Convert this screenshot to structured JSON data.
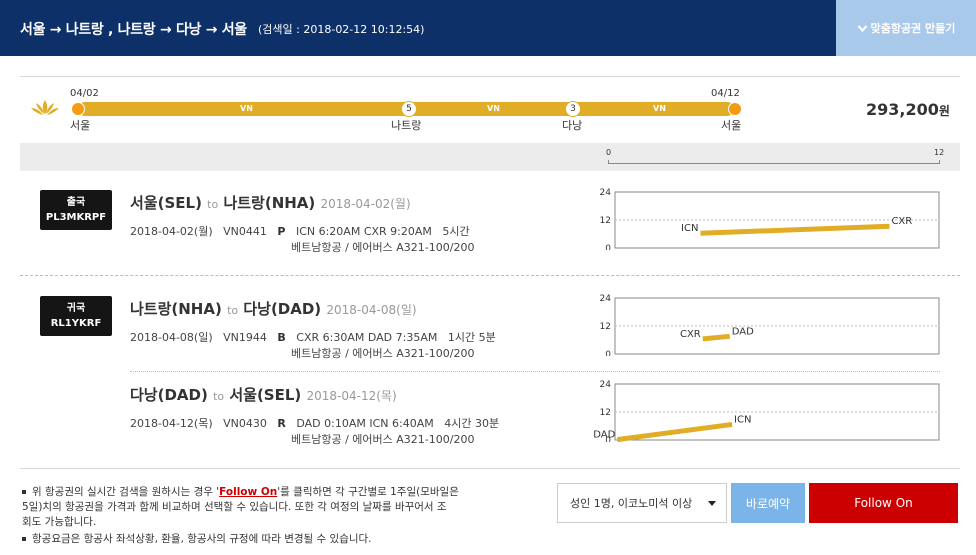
{
  "header": {
    "route": "서울 → 나트랑 , 나트랑 → 다낭 → 서울",
    "search_date": "(검색일 : 2018-02-12 10:12:54)",
    "custom_button": "맞춤항공권 만들기"
  },
  "summary": {
    "start_date": "04/02",
    "end_date": "04/12",
    "airline_code": "VN",
    "stops": [
      {
        "city": "서울"
      },
      {
        "day": "5",
        "city": "나트랑"
      },
      {
        "day": "3",
        "city": "다낭"
      },
      {
        "city": "서울"
      }
    ],
    "price": "293,200",
    "price_unit": "원",
    "scale_min": "0",
    "scale_max": "12"
  },
  "segments": [
    {
      "badge_type": "출국",
      "badge_code": "PL3MKRPF",
      "from": "서울(SEL)",
      "to_word": "to",
      "to": "나트랑(NHA)",
      "date_text": "2018-04-02(월)",
      "flights": [
        {
          "date": "2018-04-02(월)",
          "flight_no": "VN0441",
          "class": "P",
          "times": "ICN 6:20AM CXR 9:20AM",
          "duration": "5시간",
          "airline": "베트남항공 / 에어버스 A321-100/200"
        }
      ]
    },
    {
      "badge_type": "귀국",
      "badge_code": "RL1YKRF",
      "from": "나트랑(NHA)",
      "to_word": "to",
      "to": "다낭(DAD)",
      "date_text": "2018-04-08(일)",
      "flights": [
        {
          "date": "2018-04-08(일)",
          "flight_no": "VN1944",
          "class": "B",
          "times": "CXR 6:30AM DAD 7:35AM",
          "duration": "1시간 5분",
          "airline": "베트남항공 / 에어버스 A321-100/200"
        }
      ]
    },
    {
      "from": "다낭(DAD)",
      "to_word": "to",
      "to": "서울(SEL)",
      "date_text": "2018-04-12(목)",
      "flights": [
        {
          "date": "2018-04-12(목)",
          "flight_no": "VN0430",
          "class": "R",
          "times": "DAD 0:10AM ICN 6:40AM",
          "duration": "4시간 30분",
          "airline": "베트남항공 / 에어버스 A321-100/200"
        }
      ]
    }
  ],
  "chart_data": [
    {
      "type": "line",
      "xlim": [
        0,
        24
      ],
      "ylim": [
        0,
        24
      ],
      "yticks": [
        "24",
        "12",
        "0"
      ],
      "color": "#e2ad26",
      "points": [
        {
          "x": 6.33,
          "y": 6.33,
          "label": "ICN"
        },
        {
          "x": 20.33,
          "y": 9.33,
          "label": "CXR"
        }
      ]
    },
    {
      "type": "line",
      "xlim": [
        0,
        24
      ],
      "ylim": [
        0,
        24
      ],
      "yticks": [
        "24",
        "12",
        "0"
      ],
      "color": "#e2ad26",
      "points": [
        {
          "x": 6.5,
          "y": 6.5,
          "label": "CXR"
        },
        {
          "x": 8.5,
          "y": 7.58,
          "label": "DAD"
        }
      ]
    },
    {
      "type": "line",
      "xlim": [
        0,
        24
      ],
      "ylim": [
        0,
        24
      ],
      "yticks": [
        "24",
        "12",
        "0"
      ],
      "color": "#e2ad26",
      "points": [
        {
          "x": 0.17,
          "y": 0.17,
          "label": "DAD"
        },
        {
          "x": 8.67,
          "y": 6.67,
          "label": "ICN"
        }
      ]
    }
  ],
  "footer": {
    "notes": [
      [
        "위 항공권의 실시간 검색을 원하시는 경우 '",
        "Follow On",
        "'를 클릭하면 각 구간별로 1주일(모바일은"
      ],
      "5일)치의 항공권을 가격과 함께 비교하며 선택할 수 있습니다. 또한 각 여정의 날짜를 바꾸어서 조",
      "회도 가능합니다.",
      "항공요금은 항공사 좌석상황, 환율, 항공사의 규정에 따라 변경될 수 있습니다."
    ],
    "passenger_select": "성인 1명, 이코노미석 이상",
    "book_button": "바로예약",
    "follow_button": "Follow On"
  }
}
